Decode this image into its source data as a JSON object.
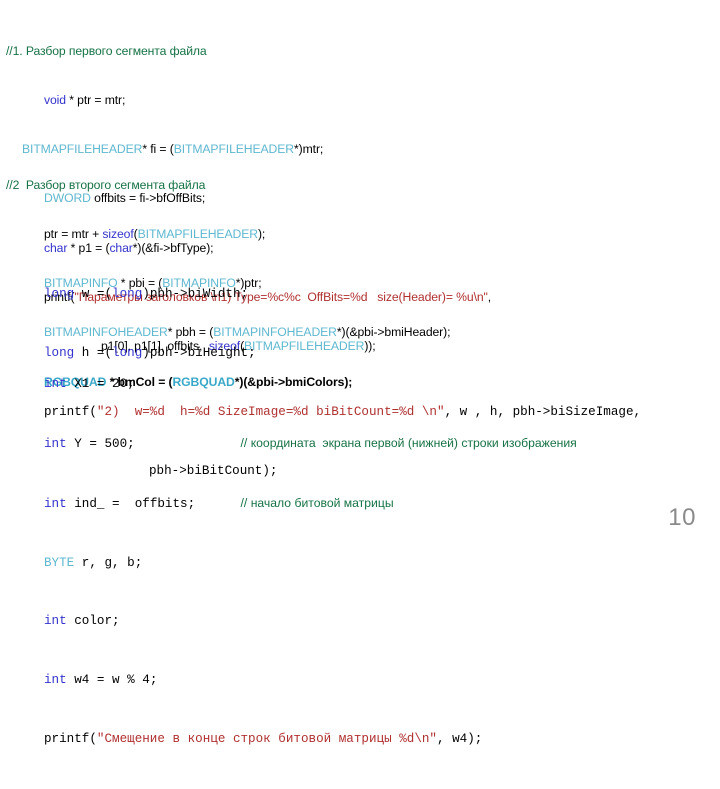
{
  "slide": {
    "page_number": "10",
    "colors": {
      "comment_green": "#177245",
      "keyword_blue": "#3333cc",
      "type_teal": "#5fb8d0",
      "type_teal_bold": "#39a8c8",
      "string_red": "#b03030",
      "plain_black": "#000000",
      "page_number_gray": "#8a8a8a",
      "background": "#ffffff"
    },
    "segment1": {
      "heading_comment": "//1. Разбор первого сегмента файла",
      "lines": [
        {
          "id": "void-ptr",
          "tokens": [
            {
              "t": "void",
              "k": "keyword"
            },
            {
              "t": " * ptr = mtr;",
              "k": "plain"
            }
          ]
        },
        {
          "id": "bitmapfileheader-fi",
          "tokens": [
            {
              "t": "BITMAPFILEHEADER",
              "k": "type"
            },
            {
              "t": "* fi = (",
              "k": "plain"
            },
            {
              "t": "BITMAPFILEHEADER",
              "k": "type"
            },
            {
              "t": "*)mtr;",
              "k": "plain"
            }
          ]
        },
        {
          "id": "dword-offbits",
          "tokens": [
            {
              "t": "DWORD",
              "k": "type"
            },
            {
              "t": " offbits = fi->bfOffBits;",
              "k": "plain"
            }
          ]
        },
        {
          "id": "char-p1",
          "tokens": [
            {
              "t": "char",
              "k": "keyword"
            },
            {
              "t": " * p1 = (",
              "k": "plain"
            },
            {
              "t": "char",
              "k": "keyword"
            },
            {
              "t": "*)(&fi->bfType);",
              "k": "plain"
            }
          ]
        },
        {
          "id": "printf-header",
          "tokens": [
            {
              "t": "printf(",
              "k": "plain"
            },
            {
              "t": "\"Параметры заголовков \\n1) Type=%c%c  OffBits=%d   size(Header)= %u\\n\"",
              "k": "string"
            },
            {
              "t": ",",
              "k": "plain"
            }
          ]
        },
        {
          "id": "printf-header-args",
          "tokens": [
            {
              "t": "p1[0], p1[1], offbits,  ",
              "k": "plain"
            },
            {
              "t": "sizeof",
              "k": "keyword"
            },
            {
              "t": "(",
              "k": "plain"
            },
            {
              "t": "BITMAPFILEHEADER",
              "k": "type"
            },
            {
              "t": "));",
              "k": "plain"
            }
          ]
        }
      ]
    },
    "segment2": {
      "heading_comment": "//2  Разбор второго сегмента файла",
      "lines": [
        {
          "id": "ptr-mtr-sizeof",
          "tokens": [
            {
              "t": "ptr = mtr + ",
              "k": "plain"
            },
            {
              "t": "sizeof",
              "k": "keyword"
            },
            {
              "t": "(",
              "k": "plain"
            },
            {
              "t": "BITMAPFILEHEADER",
              "k": "type"
            },
            {
              "t": ");",
              "k": "plain"
            }
          ]
        },
        {
          "id": "bitmapinfo-pbi",
          "tokens": [
            {
              "t": "BITMAPINFO",
              "k": "type"
            },
            {
              "t": " * pbi = (",
              "k": "plain"
            },
            {
              "t": "BITMAPINFO",
              "k": "type"
            },
            {
              "t": "*)ptr;",
              "k": "plain"
            }
          ]
        },
        {
          "id": "bitmapinfoheader-pbh",
          "tokens": [
            {
              "t": "BITMAPINFOHEADER",
              "k": "type"
            },
            {
              "t": "* pbh = (",
              "k": "plain"
            },
            {
              "t": "BITMAPINFOHEADER",
              "k": "type"
            },
            {
              "t": "*)(&pbi->bmiHeader);",
              "k": "plain"
            }
          ]
        },
        {
          "id": "rgbquad-bmcol",
          "tokens": [
            {
              "t": "RGBQUAD",
              "k": "type-b"
            },
            {
              "t": " * bmCol = (",
              "k": "bold"
            },
            {
              "t": "RGBQUAD",
              "k": "type-b"
            },
            {
              "t": "*)(&pbi->bmiColors);",
              "k": "bold"
            }
          ]
        }
      ]
    },
    "dimensions_block": {
      "lines": [
        {
          "id": "long-w",
          "tokens": [
            {
              "t": "long",
              "k": "keyword"
            },
            {
              "t": " w =(",
              "k": "plain"
            },
            {
              "t": "long",
              "k": "keyword"
            },
            {
              "t": ")pbh->biWidth;",
              "k": "plain"
            }
          ]
        },
        {
          "id": "long-h",
          "tokens": [
            {
              "t": "long",
              "k": "keyword"
            },
            {
              "t": " h =(",
              "k": "plain"
            },
            {
              "t": "long",
              "k": "keyword"
            },
            {
              "t": ")pbh->biHeight;",
              "k": "plain"
            }
          ]
        },
        {
          "id": "printf-dims",
          "tokens": [
            {
              "t": "printf(",
              "k": "plain"
            },
            {
              "t": "\"2)  w=%d  h=%d SizeImage=%d biBitCount=%d \\n\"",
              "k": "string"
            },
            {
              "t": ", w , h, pbh->biSizeImage,",
              "k": "plain"
            }
          ]
        },
        {
          "id": "printf-dims-args",
          "tokens": [
            {
              "t": "pbh->biBitCount);",
              "k": "plain"
            }
          ]
        }
      ]
    },
    "vars_block": {
      "lines": [
        {
          "id": "int-x1",
          "tokens": [
            {
              "t": "int",
              "k": "keyword"
            },
            {
              "t": " X1 = 20;",
              "k": "plain"
            }
          ],
          "comment": ""
        },
        {
          "id": "int-y",
          "tokens": [
            {
              "t": "int",
              "k": "keyword"
            },
            {
              "t": " Y = 500;",
              "k": "plain"
            }
          ],
          "comment": "// координата  экрана первой (нижней) строки изображения"
        },
        {
          "id": "int-ind",
          "tokens": [
            {
              "t": "int",
              "k": "keyword"
            },
            {
              "t": " ind_ =  offbits;",
              "k": "plain"
            }
          ],
          "comment": "// начало битовой матрицы"
        },
        {
          "id": "byte-rgb",
          "tokens": [
            {
              "t": "BYTE",
              "k": "type"
            },
            {
              "t": " r, g, b;",
              "k": "plain"
            }
          ],
          "comment": ""
        },
        {
          "id": "int-color",
          "tokens": [
            {
              "t": "int",
              "k": "keyword"
            },
            {
              "t": " color;",
              "k": "plain"
            }
          ],
          "comment": ""
        },
        {
          "id": "int-w4",
          "tokens": [
            {
              "t": "int",
              "k": "keyword"
            },
            {
              "t": " w4 = w % 4;",
              "k": "plain"
            }
          ],
          "comment": ""
        },
        {
          "id": "printf-offset",
          "tokens": [
            {
              "t": "printf(",
              "k": "plain"
            },
            {
              "t": "\"Смещение в конце строк битовой матрицы %d\\n\"",
              "k": "string"
            },
            {
              "t": ", w4);",
              "k": "plain"
            }
          ],
          "comment": ""
        }
      ]
    }
  }
}
